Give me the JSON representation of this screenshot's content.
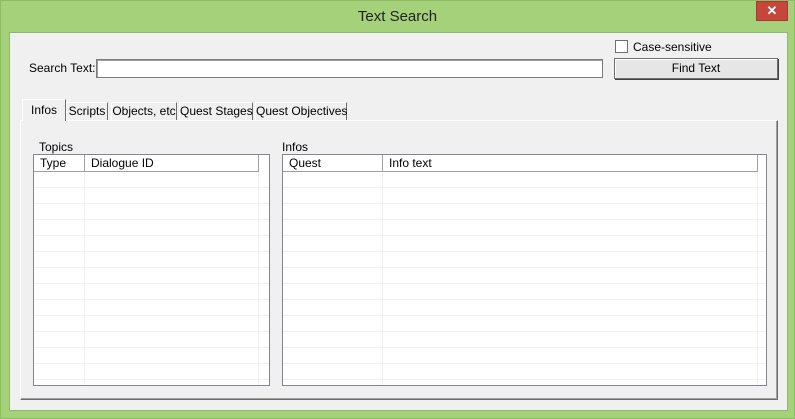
{
  "window": {
    "title": "Text Search",
    "close_glyph": "✕"
  },
  "search": {
    "label": "Search Text:",
    "value": "",
    "case_sensitive_label": "Case-sensitive",
    "case_sensitive_checked": false,
    "find_button_label": "Find Text"
  },
  "tabs": [
    {
      "label": "Infos",
      "active": true
    },
    {
      "label": "Scripts",
      "active": false
    },
    {
      "label": "Objects, etc",
      "active": false
    },
    {
      "label": "Quest Stages",
      "active": false
    },
    {
      "label": "Quest Objectives",
      "active": false
    }
  ],
  "topics": {
    "group_label": "Topics",
    "columns": [
      "Type",
      "Dialogue ID"
    ],
    "rows": []
  },
  "infos": {
    "group_label": "Infos",
    "columns": [
      "Quest",
      "Info text"
    ],
    "rows": []
  }
}
